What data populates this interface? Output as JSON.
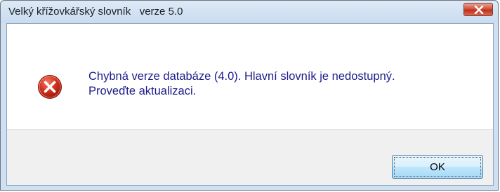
{
  "window": {
    "title": "Velký křížovkářský slovník   verze 5.0"
  },
  "icons": {
    "close": "close-icon",
    "error": "error-icon"
  },
  "message": {
    "line1": "Chybná verze databáze (4.0). Hlavní slovník je nedostupný.",
    "line2": "Proveďte aktualizaci."
  },
  "buttons": {
    "ok_label": "OK"
  },
  "colors": {
    "message_text": "#1b1b8a",
    "close_button": "#c0301c",
    "error_icon": "#c0291b"
  }
}
